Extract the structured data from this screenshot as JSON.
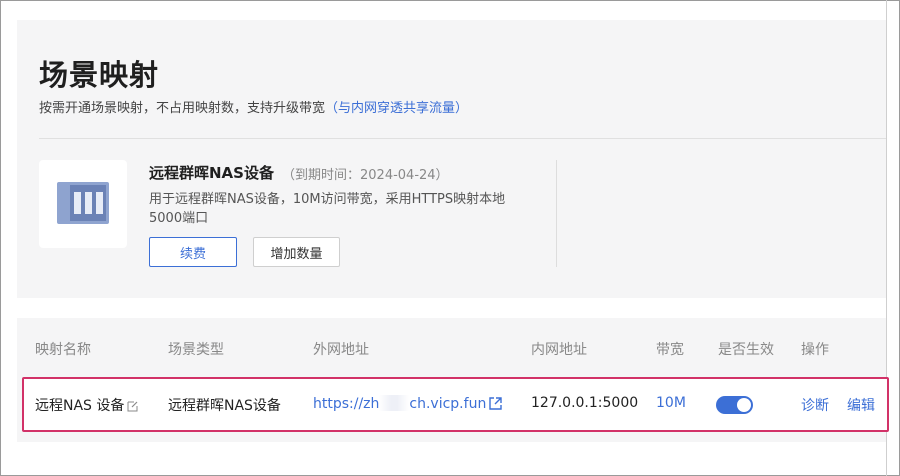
{
  "header": {
    "title": "场景映射",
    "subtitle": "按需开通场景映射，不占用映射数，支持升级带宽",
    "subtitle_link": "（与内网穿透共享流量）"
  },
  "product": {
    "name": "远程群晖NAS设备",
    "expire": "（到期时间：2024-04-24）",
    "description": "用于远程群晖NAS设备，10M访问带宽，采用HTTPS映射本地5000端口",
    "renew_label": "续费",
    "add_label": "增加数量",
    "icon": "nas-device-icon"
  },
  "table": {
    "columns": [
      "映射名称",
      "场景类型",
      "外网地址",
      "内网地址",
      "带宽",
      "是否生效",
      "操作"
    ],
    "rows": [
      {
        "name": "远程NAS 设备",
        "type": "远程群晖NAS设备",
        "external_prefix": "https://zh",
        "external_suffix": "ch.vicp.fun",
        "internal": "127.0.0.1:5000",
        "bandwidth": "10M",
        "enabled": true,
        "action_diagnose": "诊断",
        "action_edit": "编辑"
      }
    ]
  },
  "colors": {
    "accent": "#3c6fd6",
    "highlight_border": "#d23268",
    "panel_bg": "#f5f5f6"
  }
}
